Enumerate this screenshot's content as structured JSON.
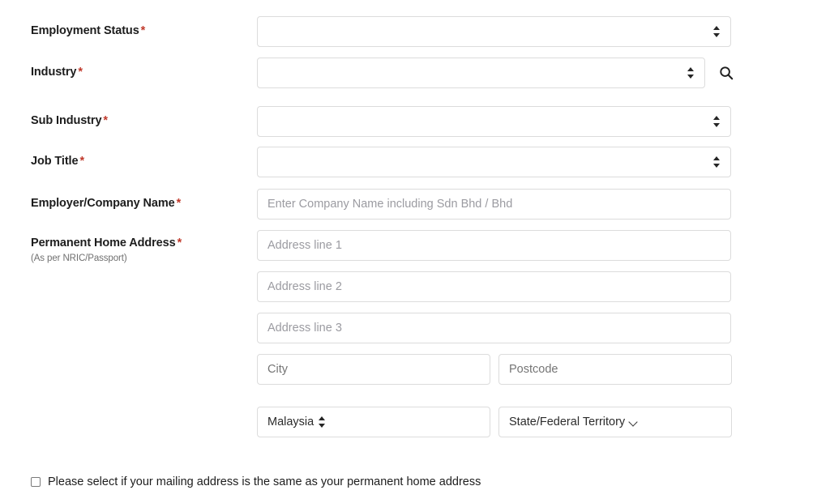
{
  "form": {
    "fields": [
      {
        "key": "employment_status",
        "label": "Employment Status",
        "required_mark": "*",
        "type": "select",
        "value": "",
        "arrow": "updown"
      },
      {
        "key": "industry",
        "label": "Industry",
        "required_mark": "*",
        "type": "select",
        "value": "",
        "arrow": "updown",
        "search_icon": "search-icon"
      },
      {
        "key": "sub_industry",
        "label": "Sub Industry",
        "required_mark": "*",
        "type": "select",
        "value": "",
        "arrow": "updown"
      },
      {
        "key": "job_title",
        "label": "Job Title",
        "required_mark": "*",
        "type": "select",
        "value": "",
        "arrow": "updown"
      },
      {
        "key": "employer_company_name",
        "label": "Employer/Company Name",
        "required_mark": "*",
        "type": "text",
        "value": "",
        "placeholder": "Enter Company Name including Sdn Bhd / Bhd"
      }
    ],
    "address": {
      "label": "Permanent Home Address",
      "required_mark": "*",
      "sub_label": "(As per NRIC/Passport)",
      "line1_placeholder": "Address line 1",
      "line2_placeholder": "Address line 2",
      "line3_placeholder": "Address line 3",
      "line1_value": "",
      "line2_value": "",
      "line3_value": "",
      "city_placeholder": "City",
      "city_value": "",
      "postcode_placeholder": "Postcode",
      "postcode_value": "",
      "country_value": "Malaysia",
      "state_value": "State/Federal Territory"
    },
    "mailing_same_checkbox": {
      "label": "Please select if your mailing address is the same as your permanent home address",
      "checked": false
    }
  },
  "colors": {
    "required_asterisk": "#c0392b",
    "label_text": "#1d1d1d",
    "placeholder_text": "#9b9ba1",
    "field_border": "#dcdcdc",
    "background": "#ffffff"
  }
}
